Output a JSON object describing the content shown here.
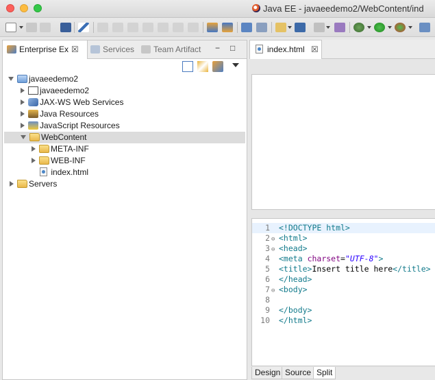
{
  "window": {
    "title": "Java EE - javaeedemo2/WebContent/ind"
  },
  "left_view": {
    "tabs": [
      {
        "label": "Enterprise Ex",
        "icon": "enterprise-explorer-icon",
        "active": true
      },
      {
        "label": "Services",
        "icon": "services-icon",
        "active": false
      },
      {
        "label": "Team Artifact",
        "icon": "team-artifact-icon",
        "active": false
      }
    ],
    "close_glyph": "☒",
    "minimize_glyph": "−",
    "maximize_glyph": "□",
    "tree": [
      {
        "label": "javaeedemo2",
        "level": 0,
        "expanded": true,
        "icon": "project-icon"
      },
      {
        "label": "javaeedemo2",
        "level": 1,
        "expanded": false,
        "icon": "deployment-descriptor-icon"
      },
      {
        "label": "JAX-WS Web Services",
        "level": 1,
        "expanded": false,
        "icon": "web-services-icon"
      },
      {
        "label": "Java Resources",
        "level": 1,
        "expanded": false,
        "icon": "java-resources-icon"
      },
      {
        "label": "JavaScript Resources",
        "level": 1,
        "expanded": false,
        "icon": "javascript-resources-icon"
      },
      {
        "label": "WebContent",
        "level": 1,
        "expanded": true,
        "icon": "folder-icon",
        "selected": true
      },
      {
        "label": "META-INF",
        "level": 2,
        "expanded": false,
        "icon": "folder-icon"
      },
      {
        "label": "WEB-INF",
        "level": 2,
        "expanded": false,
        "icon": "folder-icon"
      },
      {
        "label": "index.html",
        "level": 2,
        "leaf": true,
        "icon": "html-file-icon"
      },
      {
        "label": "Servers",
        "level": 0,
        "expanded": false,
        "icon": "folder-icon"
      }
    ]
  },
  "editor": {
    "tab_label": "index.html",
    "close_glyph": "☒",
    "lines": [
      {
        "n": "1",
        "fold": "",
        "html": "<span class=\"tag\">&lt;!DOCTYPE html&gt;</span>"
      },
      {
        "n": "2",
        "fold": "⊖",
        "html": "<span class=\"tag\">&lt;html&gt;</span>"
      },
      {
        "n": "3",
        "fold": "⊖",
        "html": "<span class=\"tag\">&lt;head&gt;</span>"
      },
      {
        "n": "4",
        "fold": "",
        "html": "<span class=\"tag\">&lt;meta</span> <span class=\"attr\">charset</span>=<span class=\"str\">\"UTF-8\"</span><span class=\"tag\">&gt;</span>"
      },
      {
        "n": "5",
        "fold": "",
        "html": "<span class=\"tag\">&lt;title&gt;</span><span class=\"txt\">Insert title here</span><span class=\"tag\">&lt;/title&gt;</span>"
      },
      {
        "n": "6",
        "fold": "",
        "html": "<span class=\"tag\">&lt;/head&gt;</span>"
      },
      {
        "n": "7",
        "fold": "⊖",
        "html": "<span class=\"tag\">&lt;body&gt;</span>"
      },
      {
        "n": "8",
        "fold": "",
        "html": ""
      },
      {
        "n": "9",
        "fold": "",
        "html": "<span class=\"tag\">&lt;/body&gt;</span>"
      },
      {
        "n": "10",
        "fold": "",
        "html": "<span class=\"tag\">&lt;/html&gt;</span>"
      }
    ],
    "bottom_tabs": [
      {
        "label": "Design",
        "active": false
      },
      {
        "label": "Source",
        "active": false
      },
      {
        "label": "Split",
        "active": true
      }
    ]
  }
}
